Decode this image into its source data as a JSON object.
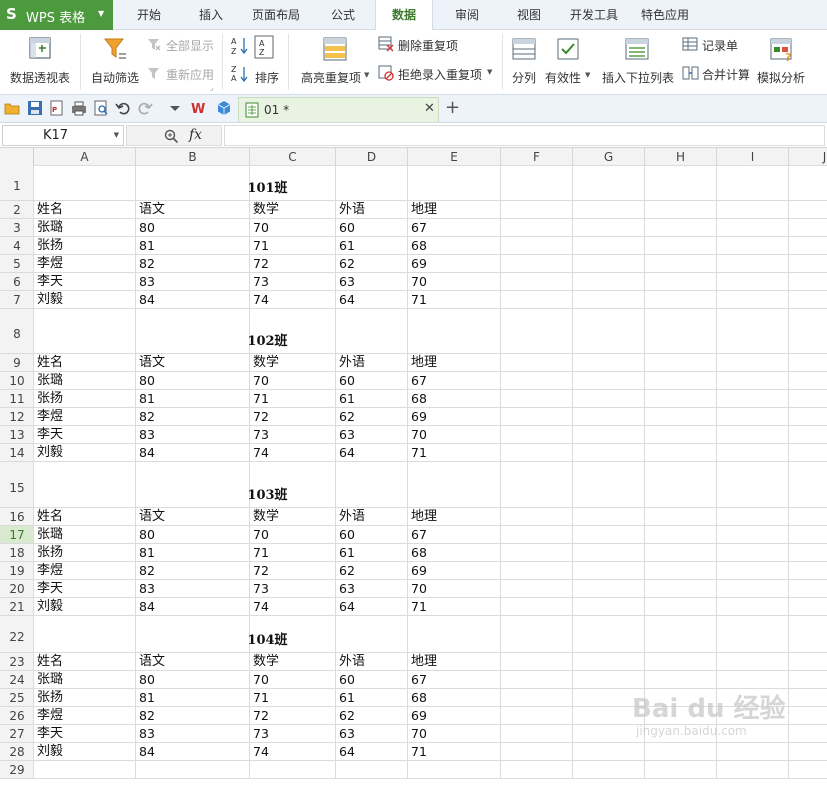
{
  "app": {
    "logo": "S",
    "name": "WPS 表格"
  },
  "menu": {
    "tabs": [
      "开始",
      "插入",
      "页面布局",
      "公式",
      "数据",
      "审阅",
      "视图",
      "开发工具",
      "特色应用"
    ],
    "active": "数据"
  },
  "ribbon": {
    "pivot": "数据透视表",
    "autofilter": "自动筛选",
    "show_all": "全部显示",
    "reapply": "重新应用",
    "sort": "排序",
    "highlight_dup": "高亮重复项",
    "delete_dup": "删除重复项",
    "reject_dup": "拒绝录入重复项",
    "split": "分列",
    "validity": "有效性",
    "insert_dropdown": "插入下拉列表",
    "record_form": "记录单",
    "consolidate": "合并计算",
    "simulate": "模拟分析"
  },
  "document": {
    "tab_title": "01 *"
  },
  "formula_bar": {
    "cell_ref": "K17",
    "fx": "fx",
    "content": ""
  },
  "columns": [
    "A",
    "B",
    "C",
    "D",
    "E",
    "F",
    "G",
    "H",
    "I",
    "J"
  ],
  "rows": [
    "1",
    "2",
    "3",
    "4",
    "5",
    "6",
    "7",
    "8",
    "9",
    "10",
    "11",
    "12",
    "13",
    "14",
    "15",
    "16",
    "17",
    "18",
    "19",
    "20",
    "21",
    "22",
    "23",
    "24",
    "25",
    "26",
    "27",
    "28",
    "29"
  ],
  "active_row": "17",
  "sheet": {
    "headers": [
      "姓名",
      "语文",
      "数学",
      "外语",
      "地理"
    ],
    "blocks": [
      {
        "title": "101班",
        "students": [
          [
            "张璐",
            "80",
            "70",
            "60",
            "67"
          ],
          [
            "张扬",
            "81",
            "71",
            "61",
            "68"
          ],
          [
            "李煜",
            "82",
            "72",
            "62",
            "69"
          ],
          [
            "李天",
            "83",
            "73",
            "63",
            "70"
          ],
          [
            "刘毅",
            "84",
            "74",
            "64",
            "71"
          ]
        ]
      },
      {
        "title": "102班",
        "students": [
          [
            "张璐",
            "80",
            "70",
            "60",
            "67"
          ],
          [
            "张扬",
            "81",
            "71",
            "61",
            "68"
          ],
          [
            "李煜",
            "82",
            "72",
            "62",
            "69"
          ],
          [
            "李天",
            "83",
            "73",
            "63",
            "70"
          ],
          [
            "刘毅",
            "84",
            "74",
            "64",
            "71"
          ]
        ]
      },
      {
        "title": "103班",
        "students": [
          [
            "张璐",
            "80",
            "70",
            "60",
            "67"
          ],
          [
            "张扬",
            "81",
            "71",
            "61",
            "68"
          ],
          [
            "李煜",
            "82",
            "72",
            "62",
            "69"
          ],
          [
            "李天",
            "83",
            "73",
            "63",
            "70"
          ],
          [
            "刘毅",
            "84",
            "74",
            "64",
            "71"
          ]
        ]
      },
      {
        "title": "104班",
        "students": [
          [
            "张璐",
            "80",
            "70",
            "60",
            "67"
          ],
          [
            "张扬",
            "81",
            "71",
            "61",
            "68"
          ],
          [
            "李煜",
            "82",
            "72",
            "62",
            "69"
          ],
          [
            "李天",
            "83",
            "73",
            "63",
            "70"
          ],
          [
            "刘毅",
            "84",
            "74",
            "64",
            "71"
          ]
        ]
      }
    ]
  },
  "watermark": {
    "brand": "Bai du 经验",
    "url": "jingyan.baidu.com"
  },
  "colors": {
    "brand_green": "#4c9a3d",
    "active_row_bg": "#d9e9cf"
  }
}
